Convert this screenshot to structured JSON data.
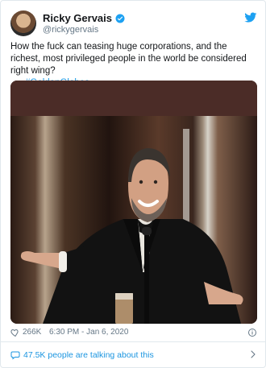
{
  "tweet": {
    "display_name": "Ricky Gervais",
    "handle": "@rickygervais",
    "text": "How the fuck can teasing huge corporations, and the richest, most  privileged people in the world be considered right wing?",
    "hashtag": "#GoldenGlobes",
    "likes": "266K",
    "time": "6:30 PM - Jan 6, 2020",
    "talking": "47.5K people are talking about this"
  },
  "icons": {
    "verified": "verified-badge-icon",
    "brand": "twitter-bird-icon",
    "heart": "heart-icon",
    "info": "info-icon",
    "talk": "speech-bubble-icon",
    "chevron": "chevron-right-icon"
  },
  "colors": {
    "link": "#1b95e0",
    "muted": "#657786",
    "text": "#14171a",
    "border": "#e1e8ed"
  }
}
